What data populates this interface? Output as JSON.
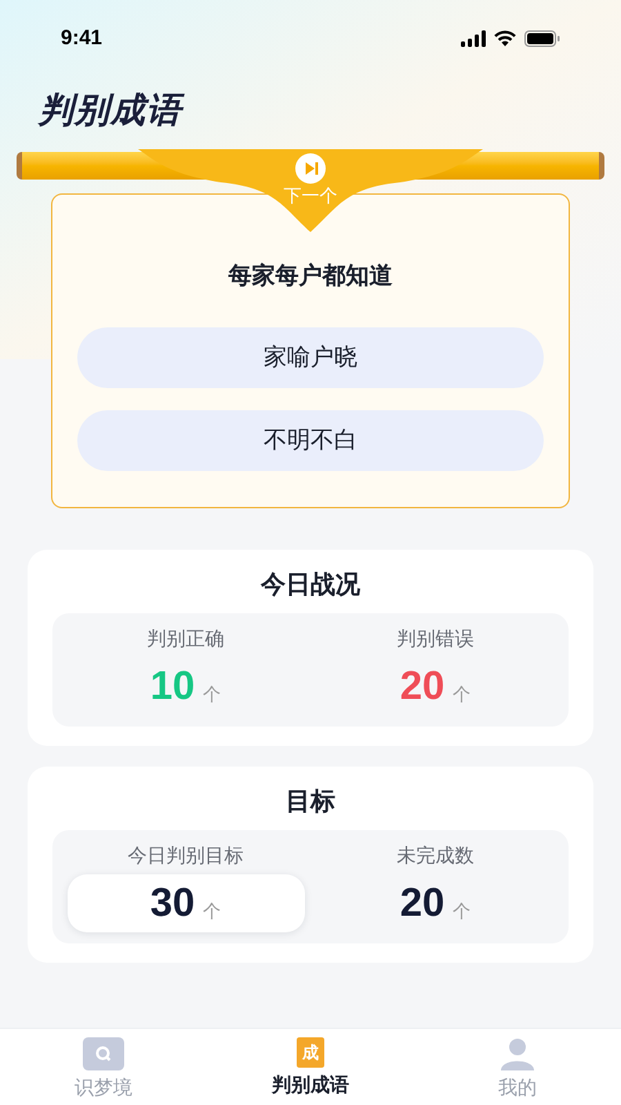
{
  "status_bar": {
    "time": "9:41"
  },
  "title": "判别成语",
  "banner": {
    "next_label": "下一个"
  },
  "question": {
    "prompt": "每家每户都知道",
    "options": [
      {
        "label": "家喻户晓",
        "selected": false
      },
      {
        "label": "不明不白",
        "selected": false
      }
    ]
  },
  "today": {
    "title": "今日战况",
    "stats": [
      {
        "label": "判别正确",
        "value": "10",
        "unit": "个",
        "color": "#16c784"
      },
      {
        "label": "判别错误",
        "value": "20",
        "unit": "个",
        "color": "#ef4d57"
      }
    ]
  },
  "goal": {
    "title": "目标",
    "stats": [
      {
        "label": "今日判别目标",
        "value": "30",
        "unit": "个",
        "selected": true
      },
      {
        "label": "未完成数",
        "value": "20",
        "unit": "个",
        "selected": false
      }
    ]
  },
  "tab_bar": [
    {
      "label": "识梦境",
      "kind": "search",
      "selected": false
    },
    {
      "label": "判别成语",
      "kind": "glyph",
      "glyph": "成",
      "selected": true
    },
    {
      "label": "我的",
      "kind": "person",
      "selected": false
    }
  ]
}
